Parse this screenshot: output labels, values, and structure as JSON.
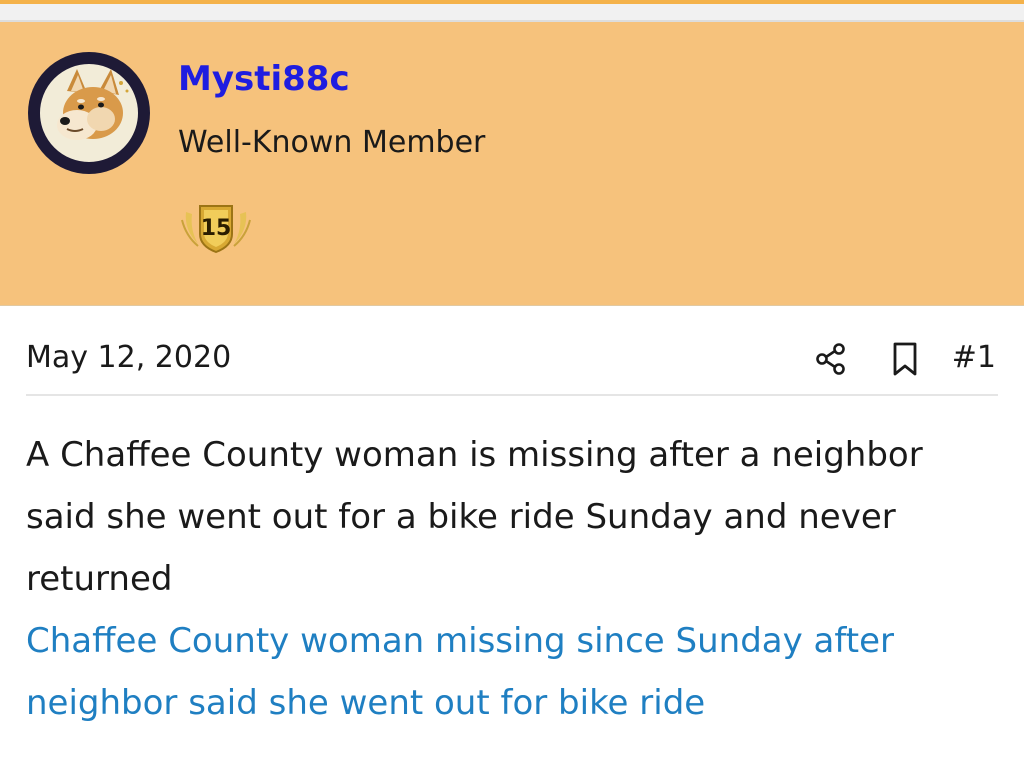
{
  "post": {
    "author": {
      "username": "Mysti88c",
      "title": "Well-Known Member",
      "badge": "15",
      "avatar_icon": "shiba-dog-icon"
    },
    "date": "May 12, 2020",
    "post_number": "#1",
    "actions": {
      "share_icon": "share-icon",
      "bookmark_icon": "bookmark-icon"
    },
    "body_text": "A Chaffee County woman is missing after a neighbor said she went out for a bike ride Sunday and never returned",
    "link_text": "Chaffee County woman missing since Sunday after neighbor said she went out for bike ride"
  },
  "colors": {
    "header_background": "#f6c27c",
    "username": "#1f1de0",
    "link": "#1f7fc2",
    "top_accent": "#f4b24a"
  }
}
